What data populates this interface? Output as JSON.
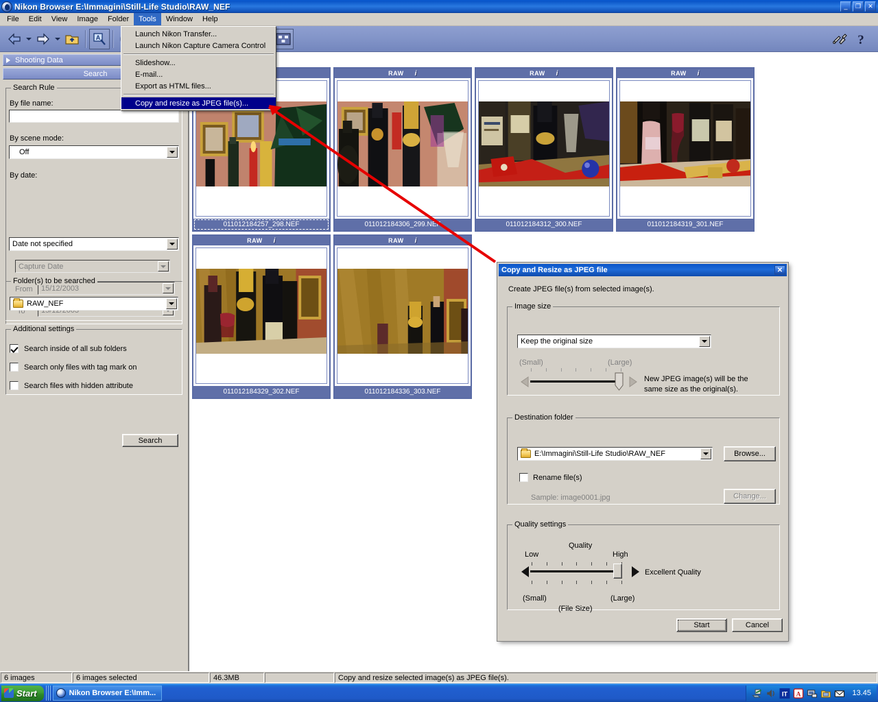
{
  "window": {
    "title": "Nikon Browser E:\\Immagini\\Still-Life Studio\\RAW_NEF",
    "minimize": "_",
    "maximize": "❐",
    "close": "✕"
  },
  "menubar": {
    "items": [
      {
        "label": "File",
        "accel": "F"
      },
      {
        "label": "Edit",
        "accel": "E"
      },
      {
        "label": "View",
        "accel": "V"
      },
      {
        "label": "Image",
        "accel": "I"
      },
      {
        "label": "Folder",
        "accel": "r"
      },
      {
        "label": "Tools",
        "accel": "T",
        "active": true
      },
      {
        "label": "Window",
        "accel": "W"
      },
      {
        "label": "Help",
        "accel": "H"
      }
    ]
  },
  "tools_menu": {
    "items": [
      {
        "label": "Launch Nikon Transfer...",
        "highlighted": false
      },
      {
        "label": "Launch Nikon Capture Camera Control",
        "highlighted": false
      },
      {
        "separator": true
      },
      {
        "label": "Slideshow...",
        "highlighted": false
      },
      {
        "label": "E-mail...",
        "highlighted": false
      },
      {
        "label": "Export as HTML files...",
        "highlighted": false
      },
      {
        "separator": true
      },
      {
        "label": "Copy and resize as JPEG file(s)...",
        "highlighted": true
      }
    ]
  },
  "toolbar": {
    "back": "back-arrow",
    "forward": "forward-arrow",
    "up": "up-folder",
    "search": "search-magnifier",
    "check": "apply-check",
    "undo": "undo-arrow",
    "print": "print",
    "slideshow": "slideshow",
    "email": "email",
    "thumbsize": "thumbnail-size-slider",
    "grid": "grid-view",
    "options": "tools-options",
    "help": "help-question"
  },
  "palettes": {
    "shooting_data": "Shooting Data",
    "search": "Search"
  },
  "search_panel": {
    "rule_legend": "Search Rule",
    "by_file_name_label": "By file name:",
    "by_file_name_value": "",
    "by_scene_mode_label": "By scene mode:",
    "by_scene_mode_value": "Off",
    "by_date_label": "By date:",
    "by_date_value": "Date not specified",
    "capture_date_value": "Capture Date",
    "from_label": "From",
    "from_value": "15/12/2003",
    "to_label": "To",
    "to_value": "15/12/2003",
    "folders_legend": "Folder(s) to be searched",
    "folders_value": "RAW_NEF",
    "additional_legend": "Additional settings",
    "checkboxes": [
      {
        "label": "Search inside of all sub folders",
        "checked": true
      },
      {
        "label": "Search only files with tag mark on",
        "checked": false
      },
      {
        "label": "Search files with hidden attribute",
        "checked": false
      }
    ],
    "search_button": "Search"
  },
  "thumbnails": {
    "badge": "RAW",
    "info_icon": "i",
    "items": [
      {
        "name": "011012184257_298.NEF",
        "selected": true
      },
      {
        "name": "011012184306_299.NEF",
        "selected": false
      },
      {
        "name": "011012184312_300.NEF",
        "selected": false
      },
      {
        "name": "011012184319_301.NEF",
        "selected": false
      },
      {
        "name": "011012184329_302.NEF",
        "selected": false
      },
      {
        "name": "011012184336_303.NEF",
        "selected": false
      }
    ]
  },
  "dialog": {
    "title": "Copy and Resize as JPEG file",
    "close_label": "✕",
    "intro": "Create JPEG file(s) from selected image(s).",
    "image_size": {
      "legend": "Image size",
      "selected_option": "Keep the original size",
      "small_label": "(Small)",
      "large_label": "(Large)",
      "note": "New JPEG image(s) will be the same size as the original(s)."
    },
    "destination": {
      "legend": "Destination folder",
      "path": "E:\\Immagini\\Still-Life Studio\\RAW_NEF",
      "browse_button": "Browse...",
      "rename_label": "Rename file(s)",
      "rename_checked": false,
      "sample": "Sample: image0001.jpg",
      "change_button": "Change..."
    },
    "quality": {
      "legend": "Quality settings",
      "title": "Quality",
      "low_label": "Low",
      "high_label": "High",
      "small_label": "(Small)",
      "large_label": "(Large)",
      "filesize_label": "(File Size)",
      "value_label": "Excellent Quality"
    },
    "start_button": "Start",
    "cancel_button": "Cancel"
  },
  "statusbar": {
    "cells": [
      "6 images",
      "6 images selected",
      "46.3MB",
      "",
      "Copy and resize selected image(s) as JPEG file(s)."
    ]
  },
  "taskbar": {
    "start": "Start",
    "task": "Nikon Browser E:\\Imm...",
    "clock": "13.45",
    "tray_icons": [
      "network-icon",
      "volume-icon",
      "language-IT-icon",
      "acrobat-icon",
      "display-icon",
      "folder-icon",
      "mail-icon"
    ]
  },
  "colors": {
    "titlebar_blue": "#0a55c8",
    "menu_highlight": "#00008b",
    "face": "#d4d0c8",
    "thumb_header": "#5f6fa8",
    "toolbar": "#8294c8",
    "arrow_red": "#e60000"
  }
}
